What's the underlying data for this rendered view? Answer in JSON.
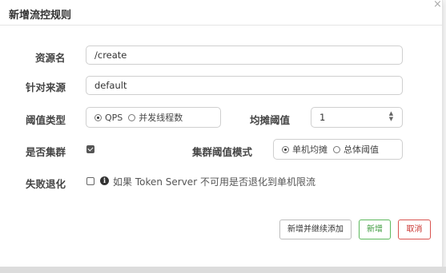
{
  "dialog": {
    "title": "新增流控规则",
    "close_glyph": "×"
  },
  "form": {
    "resource_name": {
      "label": "资源名",
      "value": "/create"
    },
    "limit_app": {
      "label": "针对来源",
      "value": "default"
    },
    "threshold_type": {
      "label": "阈值类型",
      "options": [
        "QPS",
        "并发线程数"
      ],
      "selected": "QPS"
    },
    "threshold_value": {
      "label": "均摊阈值",
      "value": "1"
    },
    "cluster_mode": {
      "label": "是否集群",
      "checked": true
    },
    "cluster_threshold_mode": {
      "label": "集群阈值模式",
      "options": [
        "单机均摊",
        "总体阈值"
      ],
      "selected": "单机均摊"
    },
    "fallback": {
      "label": "失败退化",
      "checked": false,
      "info_glyph": "i",
      "help": "如果 Token Server 不可用是否退化到单机限流"
    }
  },
  "footer": {
    "add_continue_label": "新增并继续添加",
    "add_label": "新增",
    "cancel_label": "取消"
  }
}
